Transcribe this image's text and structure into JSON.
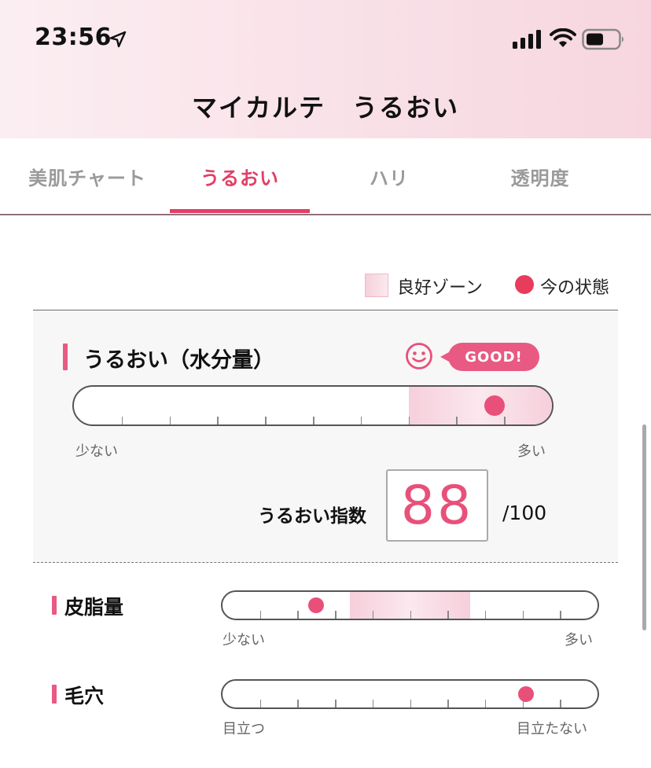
{
  "status_bar": {
    "time": "23:56",
    "icons": [
      "location-arrow-icon",
      "signal-icon",
      "wifi-icon",
      "battery-icon"
    ]
  },
  "header": {
    "title": "マイカルテ　うるおい"
  },
  "tabs": [
    {
      "label": "美肌チャート",
      "active": false
    },
    {
      "label": "うるおい",
      "active": true
    },
    {
      "label": "ハリ",
      "active": false
    },
    {
      "label": "透明度",
      "active": false
    }
  ],
  "legend": {
    "good_zone": "良好ゾーン",
    "current_state": "今の状態"
  },
  "moisture": {
    "title": "うるおい（水分量）",
    "badge": "GOOD!",
    "scale_low": "少ない",
    "scale_high": "多い",
    "good_zone_range": [
      0.7,
      1.0
    ],
    "current_position": 0.88,
    "index_label": "うるおい指数",
    "index_value": "88",
    "index_max": "/100"
  },
  "sebum": {
    "title": "皮脂量",
    "scale_low": "少ない",
    "scale_high": "多い",
    "good_zone_range": [
      0.34,
      0.66
    ],
    "current_position": 0.25
  },
  "pores": {
    "title": "毛穴",
    "scale_low": "目立つ",
    "scale_high": "目立たない",
    "current_position": 0.81
  },
  "colors": {
    "accent": "#e23e66",
    "indicator": "#e8507a",
    "header_gradient": [
      "#fbeef2",
      "#f7d6df"
    ]
  }
}
